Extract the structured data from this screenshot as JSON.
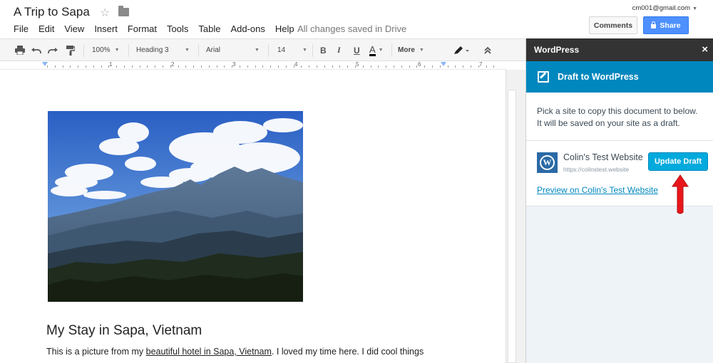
{
  "document": {
    "title": "A Trip to Sapa",
    "save_status": "All changes saved in Drive",
    "heading": "My Stay in Sapa, Vietnam",
    "paragraph_before_link": "This is a picture from my ",
    "paragraph_link": "beautiful hotel in Sapa, Vietnam",
    "paragraph_after_link": ". I loved my time here. I did cool things"
  },
  "menu": [
    "File",
    "Edit",
    "View",
    "Insert",
    "Format",
    "Tools",
    "Table",
    "Add-ons",
    "Help"
  ],
  "account": {
    "email": "cm001@gmail.com"
  },
  "buttons": {
    "comments": "Comments",
    "share": "Share"
  },
  "toolbar": {
    "zoom": "100%",
    "style": "Heading 3",
    "font": "Arial",
    "font_size": "14",
    "bold": "B",
    "italic": "I",
    "underline": "U",
    "text_color": "A",
    "more": "More"
  },
  "ruler": {
    "numbers": [
      "1",
      "2",
      "3",
      "4",
      "5",
      "6",
      "7"
    ]
  },
  "sidebar": {
    "title": "WordPress",
    "close": "×",
    "banner": "Draft to WordPress",
    "intro": "Pick a site to copy this document to below. It will be saved on your site as a draft.",
    "site_name": "Colin's Test Website",
    "site_url": "https://colinstest.website",
    "update_button": "Update Draft",
    "preview_link": "Preview on Colin's Test Website"
  },
  "colors": {
    "share_blue": "#4d90fe",
    "wp_blue": "#0087be",
    "update_blue": "#00aadc",
    "sidebar_bg": "#eef3f8",
    "arrow_red": "#e8161a"
  }
}
